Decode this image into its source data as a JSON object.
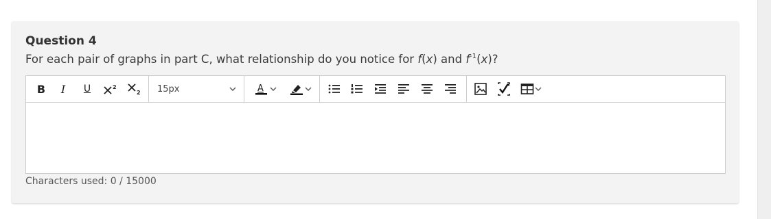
{
  "question": {
    "title": "Question 4",
    "text_part1": "For each pair of graphs in part C, what relationship do you notice for ",
    "fx": "f",
    "fx_paren_open": "(",
    "fx_var": "x",
    "fx_paren_close": ")",
    "and": " and ",
    "finv": "f",
    "finv_sup": "-1",
    "finv_paren_open": "(",
    "finv_var": "x",
    "finv_paren_close": ")?"
  },
  "toolbar": {
    "bold_label": "B",
    "italic_label": "I",
    "underline_label": "U",
    "font_size_value": "15px",
    "font_color_letter": "A"
  },
  "editor": {
    "content": ""
  },
  "footer": {
    "characters_used": "Characters used: 0 / 15000"
  },
  "icons": {
    "bold": "bold-icon",
    "italic": "italic-icon",
    "underline": "underline-icon",
    "superscript": "superscript-icon",
    "subscript": "subscript-icon",
    "font_color": "font-color-icon",
    "highlight": "highlight-icon",
    "bulleted_list": "bulleted-list-icon",
    "numbered_list": "numbered-list-icon",
    "indent": "indent-icon",
    "align_left": "align-left-icon",
    "align_center": "align-center-icon",
    "align_right": "align-right-icon",
    "image": "image-icon",
    "math": "math-icon",
    "table": "table-icon"
  },
  "colors": {
    "card_bg": "#f3f3f3",
    "border": "#cccccc",
    "text": "#333333",
    "icon": "#222222"
  }
}
